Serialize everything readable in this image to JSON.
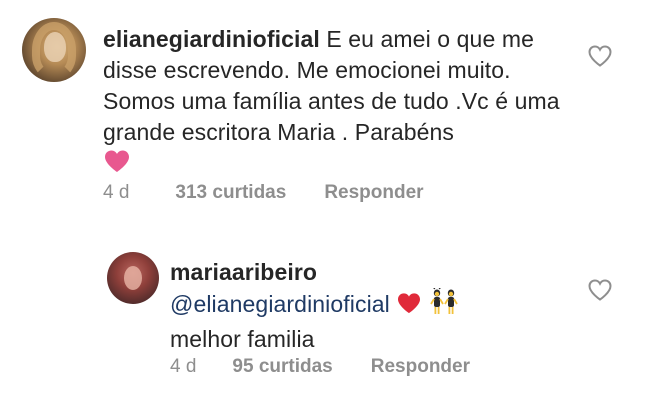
{
  "comments": [
    {
      "username": "elianegiardinioficial",
      "text": "E eu amei o que me disse escrevendo. Me emocionei muito. Somos uma família antes de tudo .Vc é uma grande escritora Maria . Parabéns",
      "emoji": "pink-heart",
      "time": "4 d",
      "likes": "313 curtidas",
      "reply_label": "Responder"
    },
    {
      "username": "mariaaribeiro",
      "mention": "@elianegiardinioficial",
      "emojis": [
        "red-heart",
        "dancing-women"
      ],
      "text": "melhor familia",
      "time": "4 d",
      "likes": "95 curtidas",
      "reply_label": "Responder"
    }
  ],
  "icons": {
    "like": "heart-outline-icon"
  },
  "colors": {
    "text": "#262626",
    "meta": "#8e8e8e",
    "mention": "#1f3a64",
    "pink_heart": "#e8588f",
    "red_heart": "#e02a3a"
  }
}
